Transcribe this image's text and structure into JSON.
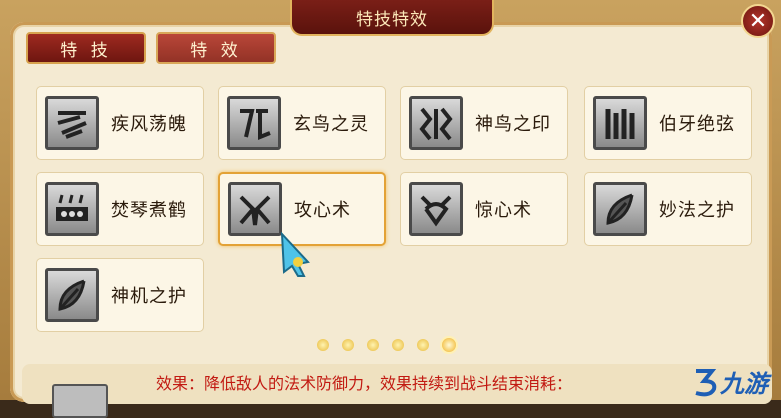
{
  "window": {
    "title": "特技特效"
  },
  "tabs": [
    {
      "label": "特 技",
      "active": true
    },
    {
      "label": "特 效",
      "active": false
    }
  ],
  "skills": [
    {
      "label": "疾风荡魄",
      "icon": "wind-icon"
    },
    {
      "label": "玄鸟之灵",
      "icon": "bird-spirit-icon"
    },
    {
      "label": "神鸟之印",
      "icon": "bird-seal-icon"
    },
    {
      "label": "伯牙绝弦",
      "icon": "zither-icon"
    },
    {
      "label": "焚琴煮鹤",
      "icon": "burning-zither-icon"
    },
    {
      "label": "攻心术",
      "icon": "heart-attack-icon",
      "selected": true
    },
    {
      "label": "惊心术",
      "icon": "heart-shock-icon"
    },
    {
      "label": "妙法之护",
      "icon": "feather-icon"
    },
    {
      "label": "神机之护",
      "icon": "feather-icon"
    }
  ],
  "pagination": {
    "count": 6,
    "active_index": 5
  },
  "description": {
    "label": "效果：",
    "text": "降低敌人的法术防御力，效果持续到战斗结束",
    "cost_label": "消耗："
  },
  "watermark": {
    "text": "九游"
  },
  "colors": {
    "accent_red": "#9e2a20",
    "gold": "#e2b45e",
    "selected_border": "#e3a236",
    "desc_red": "#c21a12"
  }
}
